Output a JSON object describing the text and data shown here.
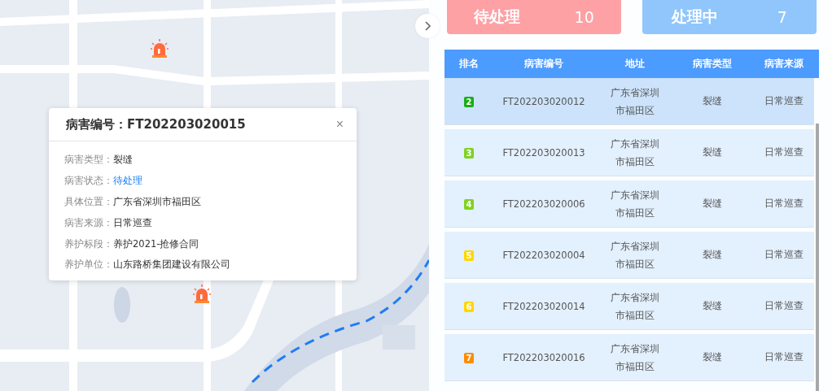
{
  "popup": {
    "title": "病害编号：FT202203020015",
    "close": "×",
    "fields": [
      {
        "label": "病害类型：",
        "value": "裂缝",
        "kind": "plain"
      },
      {
        "label": "病害状态：",
        "value": "待处理",
        "kind": "status"
      },
      {
        "label": "具体位置：",
        "value": "广东省深圳市福田区",
        "kind": "plain"
      },
      {
        "label": "病害来源：",
        "value": "日常巡查",
        "kind": "plain"
      },
      {
        "label": "养护标段：",
        "value": "养护2021-抢修合同",
        "kind": "plain"
      },
      {
        "label": "养护单位：",
        "value": "山东路桥集团建设有限公司",
        "kind": "plain"
      }
    ]
  },
  "summary": [
    {
      "label": "待处理",
      "count": "10",
      "kind": "pending"
    },
    {
      "label": "处理中",
      "count": "7",
      "kind": "processing"
    }
  ],
  "table": {
    "columns": [
      "排名",
      "病害编号",
      "地址",
      "病害类型",
      "病害来源"
    ],
    "rows": [
      {
        "rank": "2",
        "color": "#1aad19",
        "id": "FT202203020012",
        "address": [
          "广东省深圳",
          "市福田区"
        ],
        "type": "裂缝",
        "source": "日常巡查",
        "selected": true
      },
      {
        "rank": "3",
        "color": "#7ed321",
        "id": "FT202203020013",
        "address": [
          "广东省深圳",
          "市福田区"
        ],
        "type": "裂缝",
        "source": "日常巡查",
        "selected": false
      },
      {
        "rank": "4",
        "color": "#7ed321",
        "id": "FT202203020006",
        "address": [
          "广东省深圳",
          "市福田区"
        ],
        "type": "裂缝",
        "source": "日常巡查",
        "selected": false
      },
      {
        "rank": "5",
        "color": "#ffd700",
        "id": "FT202203020004",
        "address": [
          "广东省深圳",
          "市福田区"
        ],
        "type": "裂缝",
        "source": "日常巡查",
        "selected": false
      },
      {
        "rank": "6",
        "color": "#ffd700",
        "id": "FT202203020014",
        "address": [
          "广东省深圳",
          "市福田区"
        ],
        "type": "裂缝",
        "source": "日常巡查",
        "selected": false
      },
      {
        "rank": "7",
        "color": "#ff8c00",
        "id": "FT202203020016",
        "address": [
          "广东省深圳",
          "市福田区"
        ],
        "type": "裂缝",
        "source": "日常巡查",
        "selected": false
      }
    ]
  }
}
